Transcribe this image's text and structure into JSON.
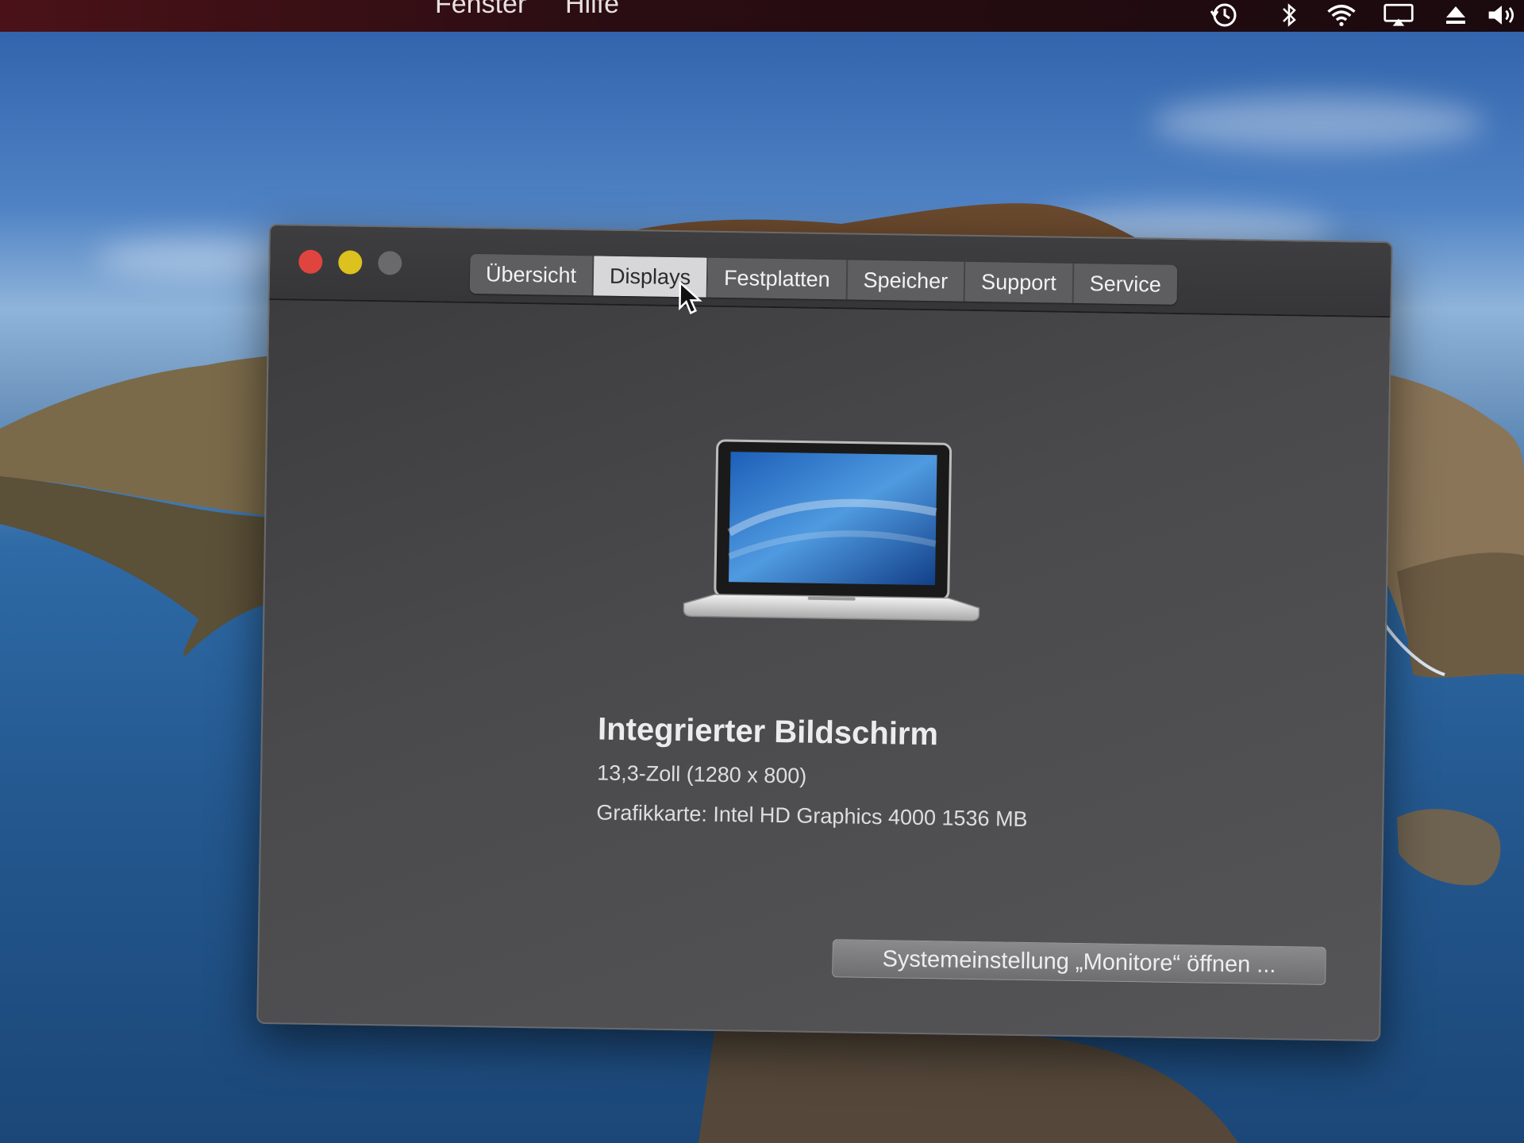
{
  "menubar": {
    "items": [
      "Fenster",
      "Hilfe"
    ],
    "status_icons": [
      "time-machine-icon",
      "bluetooth-icon",
      "wifi-icon",
      "airplay-icon",
      "eject-icon",
      "volume-icon"
    ]
  },
  "window": {
    "tabs": [
      {
        "label": "Übersicht",
        "active": false
      },
      {
        "label": "Displays",
        "active": true
      },
      {
        "label": "Festplatten",
        "active": false
      },
      {
        "label": "Speicher",
        "active": false
      },
      {
        "label": "Support",
        "active": false
      },
      {
        "label": "Service",
        "active": false
      }
    ],
    "display": {
      "title": "Integrierter Bildschirm",
      "size": "13,3-Zoll (1280 x 800)",
      "gpu": "Grafikkarte: Intel HD Graphics 4000 1536 MB"
    },
    "button_label": "Systemeinstellung „Monitore“ öffnen ..."
  },
  "colors": {
    "close": "#e0443e",
    "minimize": "#dcc11f",
    "zoom_disabled": "#6a6a6c",
    "active_tab": "#d7d7d9"
  }
}
